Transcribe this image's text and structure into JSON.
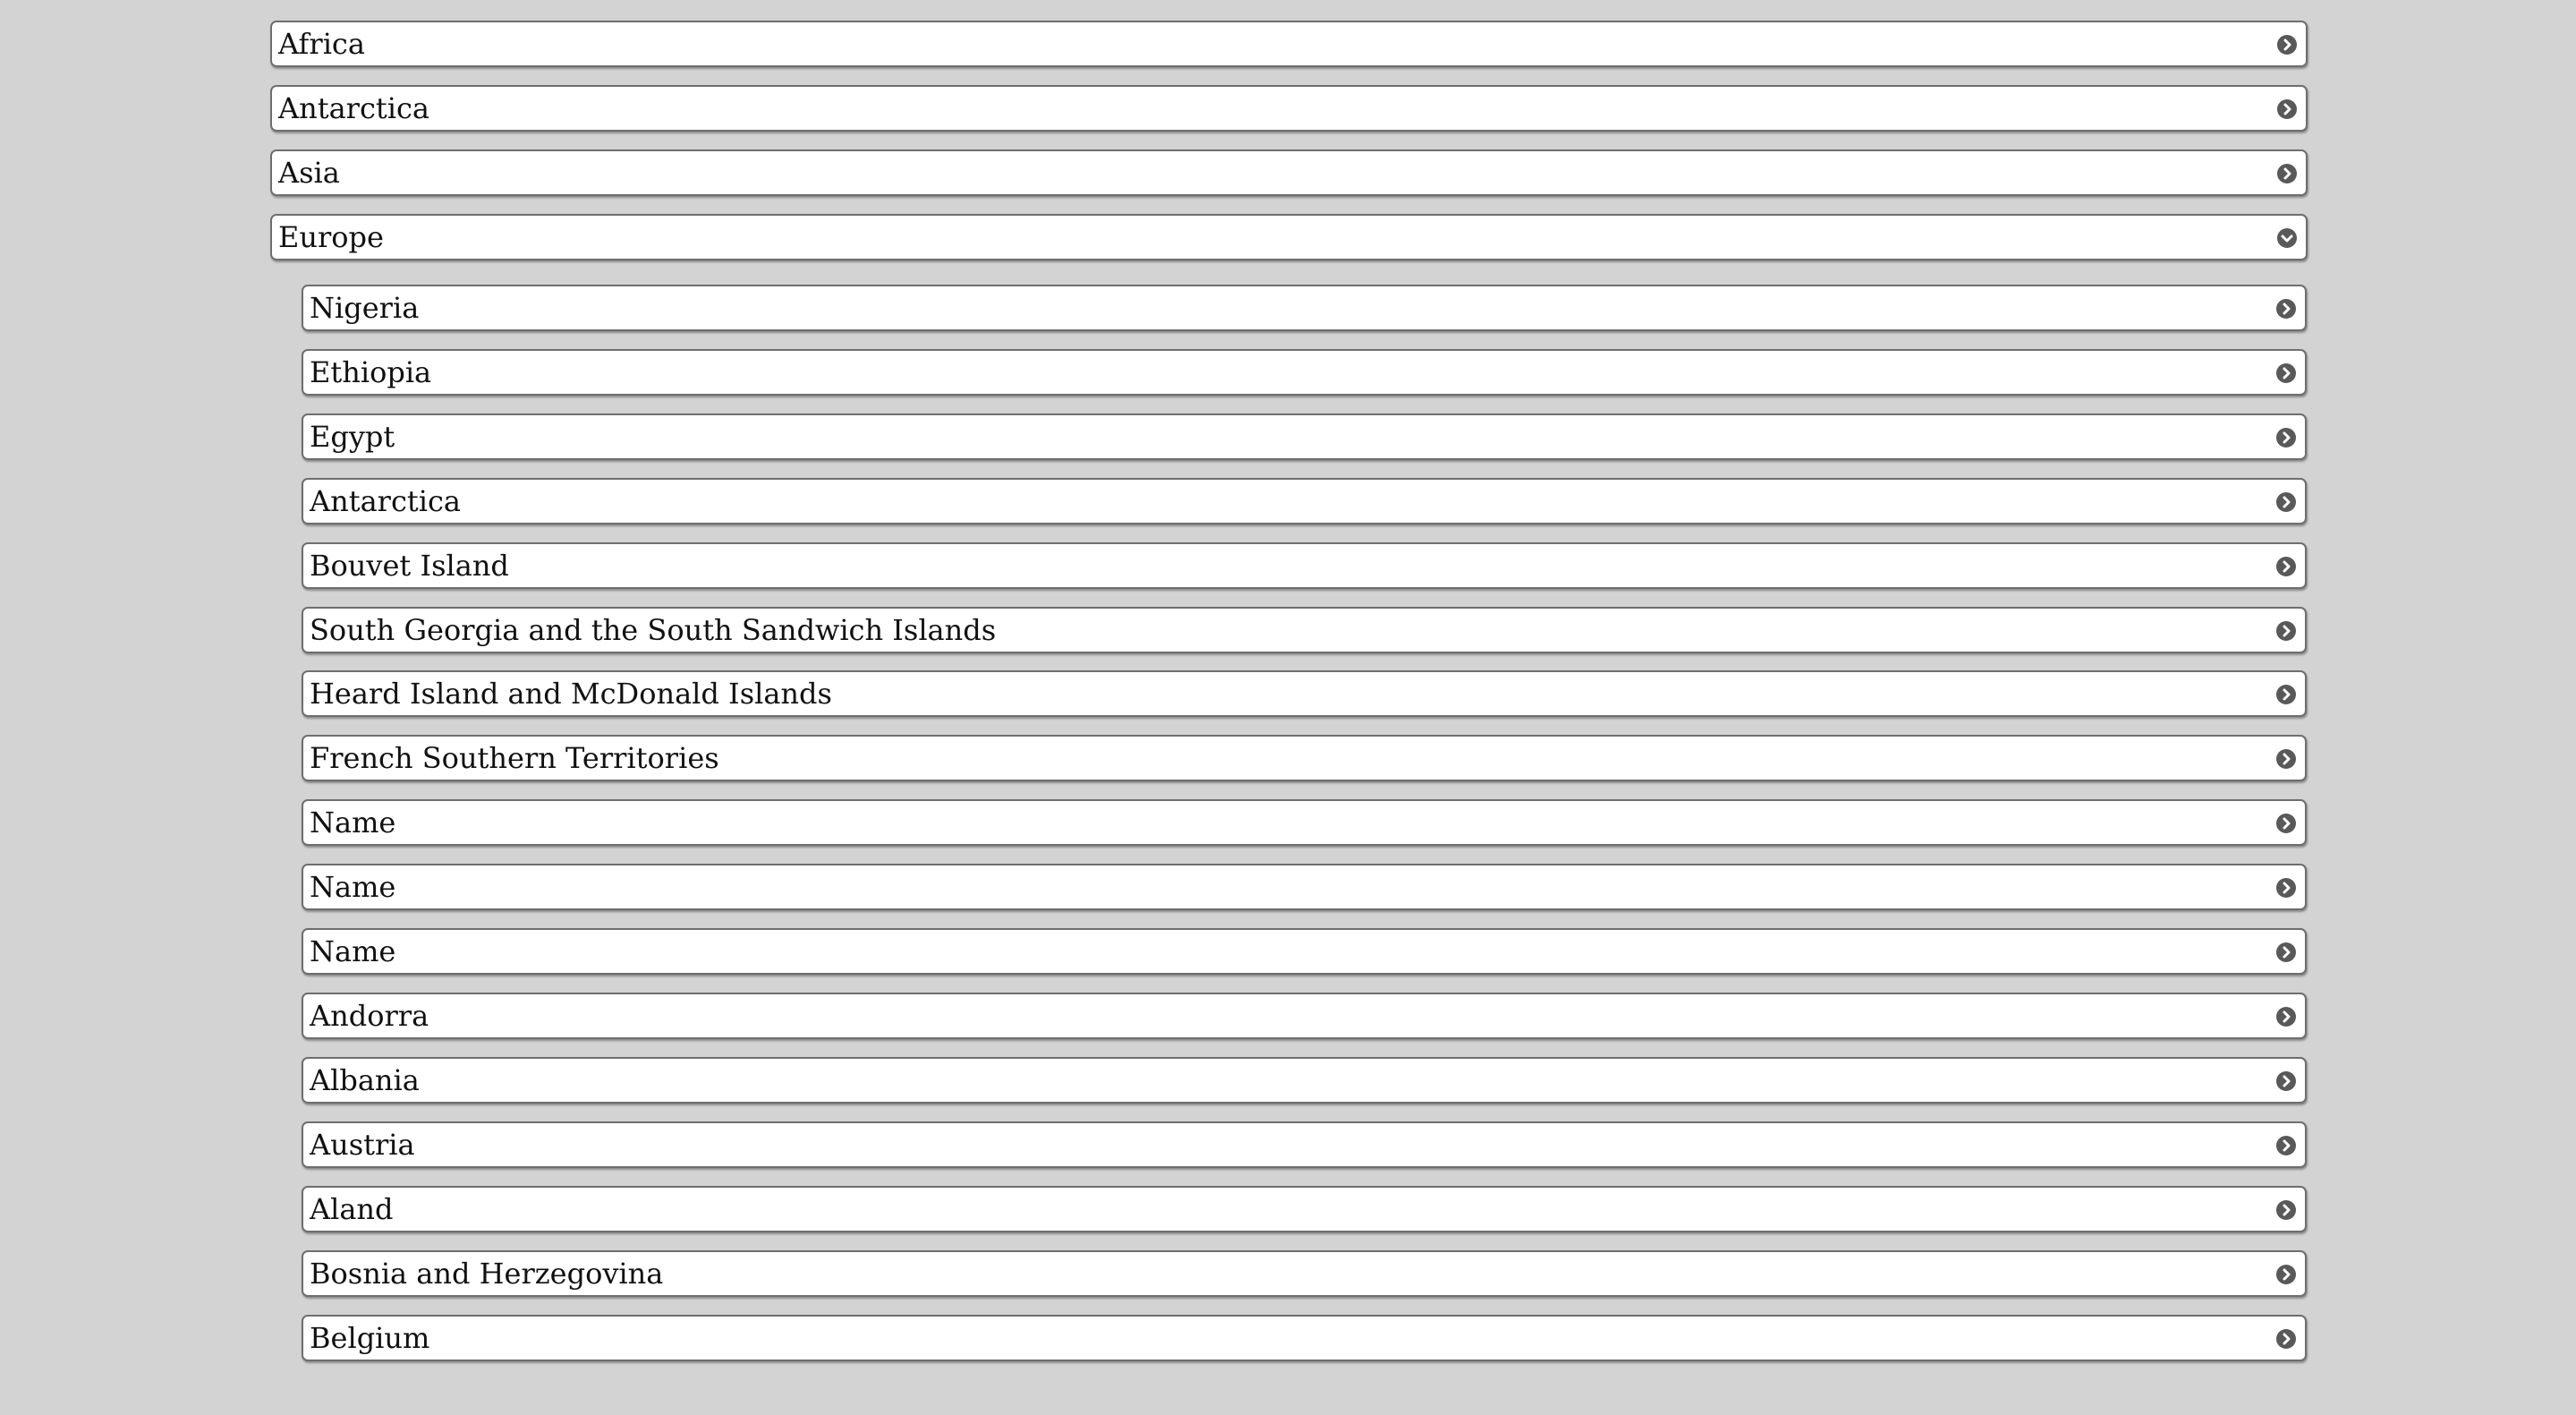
{
  "regions": [
    {
      "label": "Africa",
      "expanded": false
    },
    {
      "label": "Antarctica",
      "expanded": false
    },
    {
      "label": "Asia",
      "expanded": false
    },
    {
      "label": "Europe",
      "expanded": true
    }
  ],
  "countries": [
    "Nigeria",
    "Ethiopia",
    "Egypt",
    "Antarctica",
    "Bouvet Island",
    "South Georgia and the South Sandwich Islands",
    "Heard Island and McDonald Islands",
    "French Southern Territories",
    "Name",
    "Name",
    "Name",
    "Andorra",
    "Albania",
    "Austria",
    "Aland",
    "Bosnia and Herzegovina",
    "Belgium"
  ],
  "icons": {
    "collapsed": "chevron-right-icon",
    "expanded": "chevron-down-icon"
  },
  "colors": {
    "background": "#d3d3d3",
    "row_background": "#ffffff",
    "row_border": "#6e6e6e",
    "icon": "#595959"
  }
}
